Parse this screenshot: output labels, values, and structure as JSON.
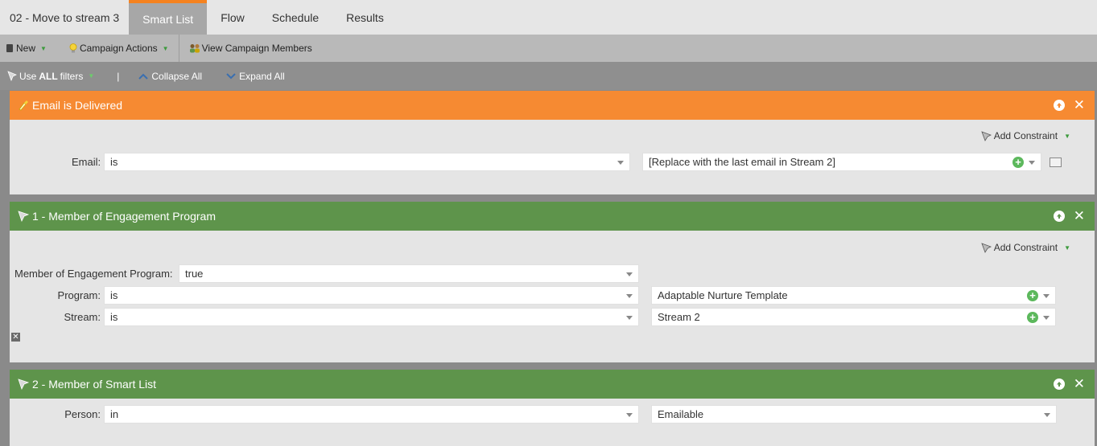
{
  "tabs": {
    "campaign_name": "02 - Move to stream 3",
    "items": [
      "Smart List",
      "Flow",
      "Schedule",
      "Results"
    ],
    "active": "Smart List"
  },
  "toolbar": {
    "new_label": "New",
    "campaign_actions_label": "Campaign Actions",
    "view_members_label": "View Campaign Members"
  },
  "filterbar": {
    "use_label": "Use",
    "all_label": "ALL",
    "filters_label": "filters",
    "pipe": "|",
    "collapse_label": "Collapse All",
    "expand_label": "Expand All"
  },
  "filters": [
    {
      "title": "Email is Delivered",
      "color": "#f68a32",
      "add_constraint": "Add Constraint",
      "email_label": "Email:",
      "email_operator": "is",
      "email_value": "[Replace with the last email in Stream 2]"
    },
    {
      "title": "1 - Member of Engagement Program",
      "color": "#5e944b",
      "add_constraint": "Add Constraint",
      "member_label": "Member of Engagement Program:",
      "member_value": "true",
      "program_label": "Program:",
      "program_operator": "is",
      "program_value": "Adaptable Nurture Template",
      "stream_label": "Stream:",
      "stream_operator": "is",
      "stream_value": "Stream 2"
    },
    {
      "title": "2 - Member of Smart List",
      "color": "#5e944b",
      "person_label": "Person:",
      "person_operator": "in",
      "person_value": "Emailable"
    }
  ],
  "icons": {
    "plus": "+",
    "close": "✕",
    "remove": "✕",
    "caret": "▼"
  }
}
